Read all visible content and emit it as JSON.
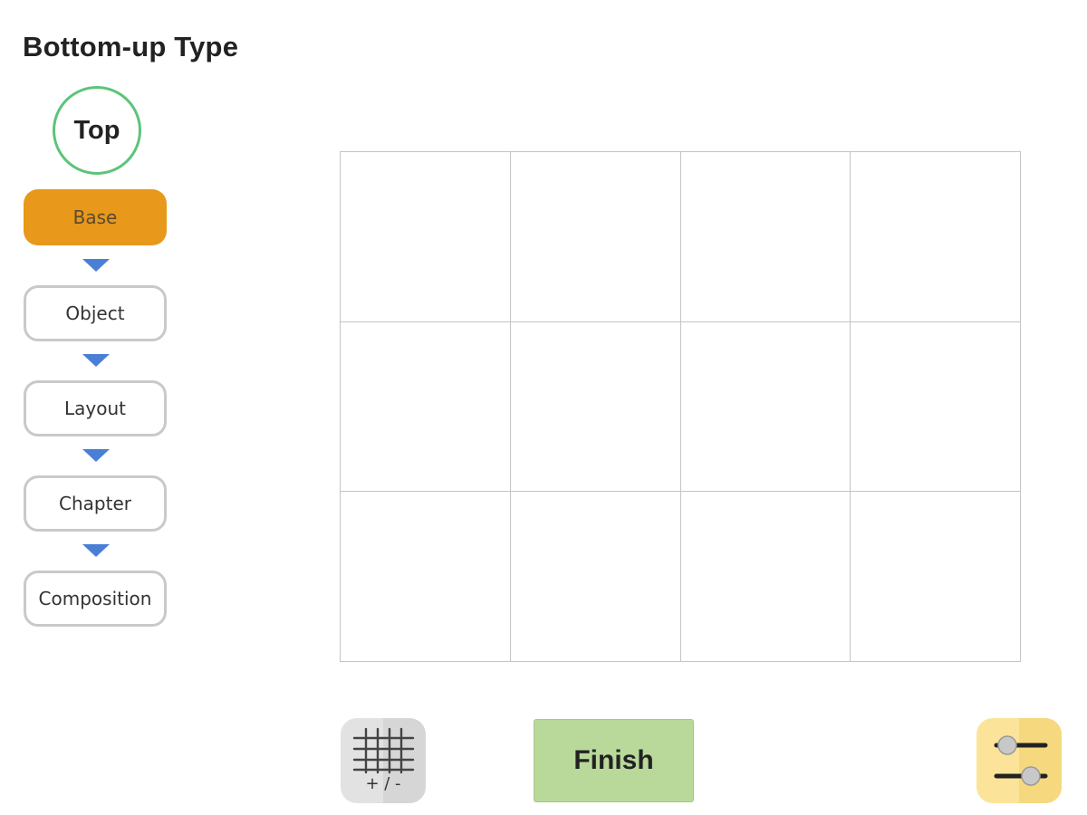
{
  "page": {
    "title": "Bottom-up Type"
  },
  "hierarchy": {
    "top_label": "Top",
    "steps": [
      {
        "label": "Base",
        "active": true
      },
      {
        "label": "Object",
        "active": false
      },
      {
        "label": "Layout",
        "active": false
      },
      {
        "label": "Chapter",
        "active": false
      },
      {
        "label": "Composition",
        "active": false
      }
    ]
  },
  "grid": {
    "rows": 3,
    "columns": 4
  },
  "toolbar": {
    "grid_button_label": "+ / -",
    "finish_label": "Finish",
    "settings_icon": "sliders-icon"
  },
  "colors": {
    "active_step": "#e8981a",
    "top_ring": "#5cc47a",
    "arrow": "#4a7fd6",
    "finish": "#b9d99b",
    "settings": "#fbe49a"
  }
}
